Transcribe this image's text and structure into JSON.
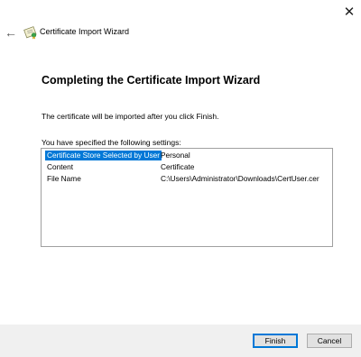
{
  "window": {
    "close_glyph": "✕"
  },
  "header": {
    "back_glyph": "←",
    "title": "Certificate Import Wizard",
    "icon": "certificate-icon"
  },
  "main": {
    "heading": "Completing the Certificate Import Wizard",
    "description": "The certificate will be imported after you click Finish.",
    "settings_label": "You have specified the following settings:",
    "settings": [
      {
        "key": "Certificate Store Selected by User",
        "value": "Personal",
        "selected": true
      },
      {
        "key": "Content",
        "value": "Certificate",
        "selected": false
      },
      {
        "key": "File Name",
        "value": "C:\\Users\\Administrator\\Downloads\\CertUser.cer",
        "selected": false
      }
    ]
  },
  "footer": {
    "finish_label": "Finish",
    "cancel_label": "Cancel"
  },
  "colors": {
    "selection": "#0078d7",
    "footer_bg": "#f0f0f0",
    "button_bg": "#e1e1e1"
  }
}
